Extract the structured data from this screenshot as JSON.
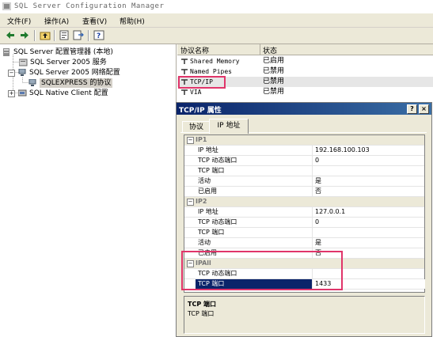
{
  "window": {
    "title": "SQL Server Configuration Manager"
  },
  "menu": [
    {
      "label": "文件(F)"
    },
    {
      "label": "操作(A)"
    },
    {
      "label": "查看(V)"
    },
    {
      "label": "帮助(H)"
    }
  ],
  "toolbar": [
    "back-arrow-icon",
    "forward-arrow-icon",
    "up-folder-icon",
    "properties-icon",
    "export-icon",
    "help-icon"
  ],
  "tree": [
    {
      "label": "SQL Server 配置管理器 (本地)"
    },
    {
      "label": "SQL Server 2005 服务"
    },
    {
      "label": "SQL Server 2005 网络配置"
    },
    {
      "label": "SQLEXPRESS 的协议"
    },
    {
      "label": "SQL Native Client 配置"
    }
  ],
  "list": {
    "headers": [
      "协议名称",
      "状态"
    ],
    "rows": [
      {
        "name": "Shared Memory",
        "status": "已启用"
      },
      {
        "name": "Named Pipes",
        "status": "已禁用"
      },
      {
        "name": "TCP/IP",
        "status": "已禁用"
      },
      {
        "name": "VIA",
        "status": "已禁用"
      }
    ]
  },
  "dialog": {
    "title": "TCP/IP 属性",
    "help_btn": "?",
    "close_btn": "×",
    "tabs": [
      "协议",
      "IP 地址"
    ],
    "sections": [
      {
        "header": "IP1",
        "rows": [
          {
            "label": "IP 地址",
            "value": "192.168.100.103"
          },
          {
            "label": "TCP 动态端口",
            "value": "0"
          },
          {
            "label": "TCP 端口",
            "value": ""
          },
          {
            "label": "活动",
            "value": "是"
          },
          {
            "label": "已启用",
            "value": "否"
          }
        ]
      },
      {
        "header": "IP2",
        "rows": [
          {
            "label": "IP 地址",
            "value": "127.0.0.1"
          },
          {
            "label": "TCP 动态端口",
            "value": "0"
          },
          {
            "label": "TCP 端口",
            "value": ""
          },
          {
            "label": "活动",
            "value": "是"
          },
          {
            "label": "已启用",
            "value": "否"
          }
        ]
      },
      {
        "header": "IPAll",
        "rows": [
          {
            "label": "TCP 动态端口",
            "value": ""
          },
          {
            "label": "TCP 端口",
            "value": "1433"
          }
        ]
      }
    ],
    "description": {
      "title": "TCP 端口",
      "text": "TCP 端口"
    }
  },
  "colors": {
    "highlight": "#e0356a",
    "selection": "#0a246a",
    "titlebar": "#0a246a"
  }
}
